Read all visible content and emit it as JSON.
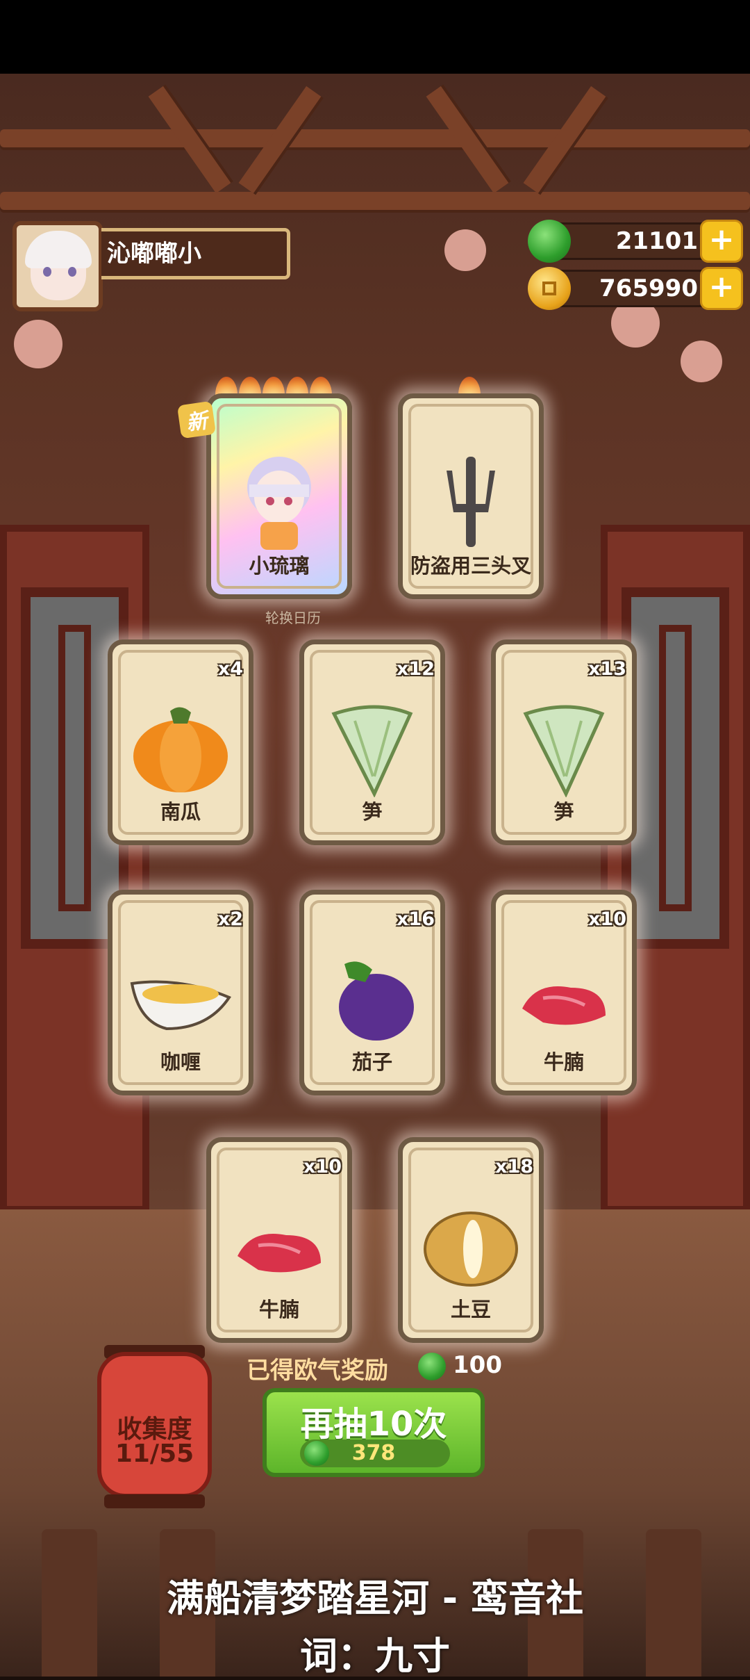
{
  "player": {
    "name": "沁嘟嘟小"
  },
  "currency": {
    "jade": {
      "value": "21101",
      "plus": "+"
    },
    "coins": {
      "value": "765990",
      "plus": "+"
    }
  },
  "special_cards": [
    {
      "label": "小琉璃",
      "badge": "新",
      "stars": 5
    },
    {
      "label": "防盗用三头叉",
      "stars": 1
    }
  ],
  "sublabel": "轮换日历",
  "cards": [
    {
      "label": "南瓜",
      "qty": "x4"
    },
    {
      "label": "笋",
      "qty": "x12"
    },
    {
      "label": "笋",
      "qty": "x13"
    },
    {
      "label": "咖喱",
      "qty": "x2"
    },
    {
      "label": "茄子",
      "qty": "x16"
    },
    {
      "label": "牛腩",
      "qty": "x10"
    },
    {
      "label": "牛腩",
      "qty": "x10"
    },
    {
      "label": "土豆",
      "qty": "x18"
    }
  ],
  "bonus": {
    "label": "已得欧气奖励",
    "value": "100"
  },
  "collection": {
    "title": "收集度",
    "value": "11/55"
  },
  "draw": {
    "title": "再抽10次",
    "cost": "378"
  },
  "lyrics": {
    "line1": "满船清梦踏星河 - 鸾音社",
    "line2": "词：九寸"
  },
  "colors": {
    "jade": "#2e9e2c",
    "coin": "#e7a21a",
    "button": "#5db52a",
    "card": "#f1e2c0"
  }
}
